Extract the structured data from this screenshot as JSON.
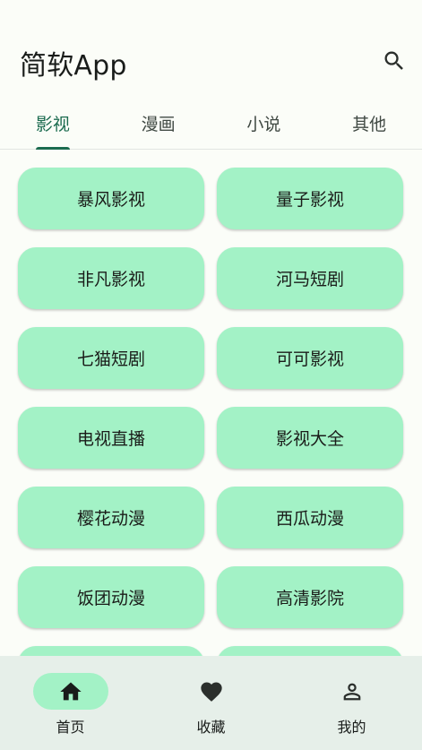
{
  "app": {
    "title": "简软App"
  },
  "tabs": [
    {
      "label": "影视",
      "active": true
    },
    {
      "label": "漫画",
      "active": false
    },
    {
      "label": "小说",
      "active": false
    },
    {
      "label": "其他",
      "active": false
    }
  ],
  "sources": [
    {
      "label": "暴风影视"
    },
    {
      "label": "量子影视"
    },
    {
      "label": "非凡影视"
    },
    {
      "label": "河马短剧"
    },
    {
      "label": "七猫短剧"
    },
    {
      "label": "可可影视"
    },
    {
      "label": "电视直播"
    },
    {
      "label": "影视大全"
    },
    {
      "label": "樱花动漫"
    },
    {
      "label": "西瓜动漫"
    },
    {
      "label": "饭团动漫"
    },
    {
      "label": "高清影院"
    },
    {
      "label": ""
    },
    {
      "label": ""
    }
  ],
  "bottom_nav": [
    {
      "label": "首页",
      "icon": "home-icon",
      "active": true
    },
    {
      "label": "收藏",
      "icon": "heart-icon",
      "active": false
    },
    {
      "label": "我的",
      "icon": "person-icon",
      "active": false
    }
  ],
  "colors": {
    "accent": "#1b6b4f",
    "card": "#a3f2c6",
    "background": "#fbfdf8",
    "nav_bar": "#e6efe9"
  }
}
